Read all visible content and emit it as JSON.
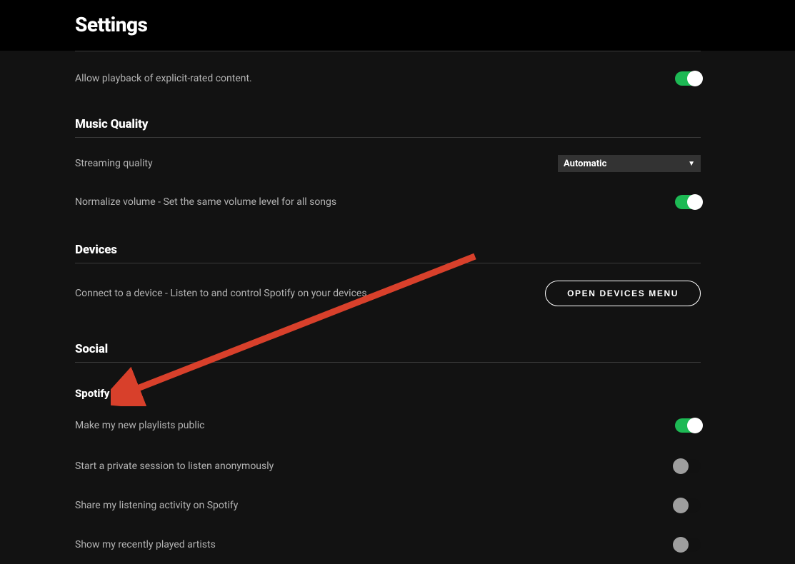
{
  "header": {
    "title": "Settings"
  },
  "explicit": {
    "label": "Allow playback of explicit-rated content.",
    "toggle_on": true
  },
  "music_quality": {
    "title": "Music Quality",
    "streaming_label": "Streaming quality",
    "streaming_value": "Automatic",
    "normalize_label": "Normalize volume - Set the same volume level for all songs",
    "normalize_on": true
  },
  "devices": {
    "title": "Devices",
    "connect_label": "Connect to a device - Listen to and control Spotify on your devices",
    "button": "OPEN DEVICES MENU"
  },
  "social": {
    "title": "Social",
    "spotify_title": "Spotify",
    "playlists_public_label": "Make my new playlists public",
    "playlists_public_on": true,
    "private_session_label": "Start a private session to listen anonymously",
    "private_session_on": false,
    "share_activity_label": "Share my listening activity on Spotify",
    "share_activity_on": false,
    "recent_artists_label": "Show my recently played artists",
    "recent_artists_on": false
  }
}
